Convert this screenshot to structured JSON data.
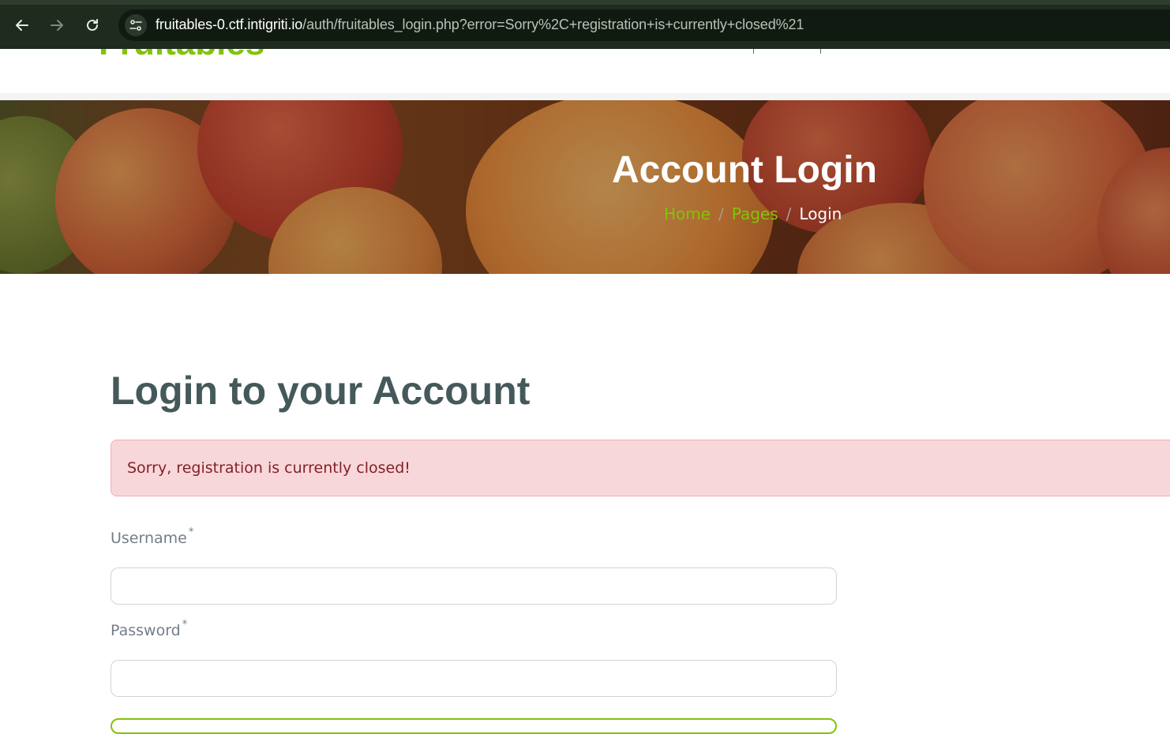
{
  "browser": {
    "url_host": "fruitables-0.ctf.intigriti.io",
    "url_path": "/auth/fruitables_login.php?error=Sorry%2C+registration+is+currently+closed%21",
    "back_icon": "back-arrow-icon",
    "forward_icon": "forward-arrow-icon",
    "reload_icon": "reload-icon",
    "site_info_icon": "tune-icon"
  },
  "header": {
    "logo": "Fruitables"
  },
  "hero": {
    "title": "Account Login",
    "breadcrumb": {
      "home": "Home",
      "pages": "Pages",
      "current": "Login",
      "separator": "/"
    }
  },
  "main": {
    "heading": "Login to your Account",
    "alert_message": "Sorry, registration is currently closed!",
    "username_label": "Username",
    "password_label": "Password",
    "required_marker": "*",
    "username_value": "",
    "password_value": ""
  },
  "colors": {
    "brand_green": "#81c408",
    "heading": "#45595b",
    "alert_bg": "#f8d7da",
    "alert_text": "#842029"
  }
}
